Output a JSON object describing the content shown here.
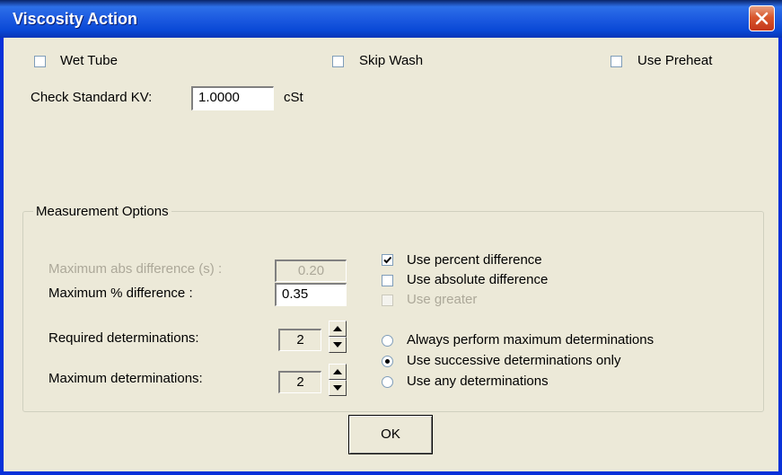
{
  "window": {
    "title": "Viscosity Action"
  },
  "options": {
    "wet_tube": {
      "label": "Wet Tube",
      "checked": false
    },
    "skip_wash": {
      "label": "Skip Wash",
      "checked": false
    },
    "use_preheat": {
      "label": "Use Preheat",
      "checked": false
    }
  },
  "check_standard": {
    "label": "Check Standard KV:",
    "value": "1.0000",
    "unit": "cSt"
  },
  "measurement": {
    "group_label": "Measurement Options",
    "max_abs": {
      "label": "Maximum abs difference (s) :",
      "value": "0.20",
      "enabled": false
    },
    "max_pct": {
      "label": "Maximum % difference :",
      "value": "0.35"
    },
    "use_percent": {
      "label": "Use percent difference",
      "checked": true
    },
    "use_absolute": {
      "label": "Use absolute difference",
      "checked": false
    },
    "use_greater": {
      "label": "Use greater",
      "checked": false,
      "enabled": false
    },
    "required": {
      "label": "Required determinations:",
      "value": "2"
    },
    "maximum": {
      "label": "Maximum determinations:",
      "value": "2"
    },
    "radio_always": {
      "label": "Always perform maximum determinations",
      "selected": false
    },
    "radio_successive": {
      "label": "Use successive determinations only",
      "selected": true
    },
    "radio_any": {
      "label": "Use any determinations",
      "selected": false
    }
  },
  "ok_button": {
    "label": "OK"
  },
  "icons": {
    "close": "close-icon",
    "check": "check-icon",
    "up": "arrow-up-icon",
    "down": "arrow-down-icon"
  },
  "colors": {
    "titlebar": "#0a49d6",
    "dialog_bg": "#ece9d8",
    "close_button": "#d9572c",
    "disabled_text": "#aca899"
  }
}
